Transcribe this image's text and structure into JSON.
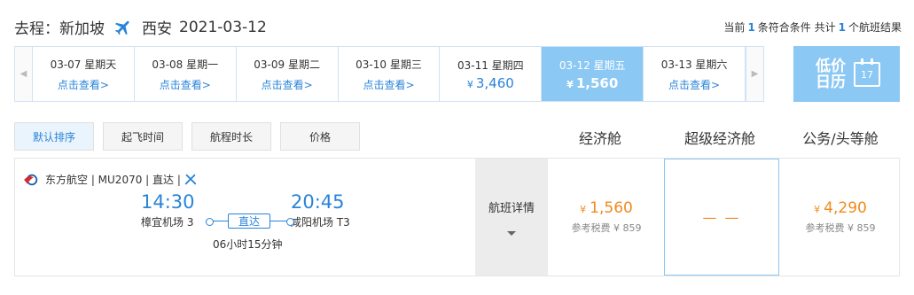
{
  "header": {
    "route_prefix": "去程：新加坡",
    "destination": "西安",
    "date": "2021-03-12",
    "result_prefix": "当前",
    "match_count": "1",
    "match_label": "条符合条件 共计",
    "total_count": "1",
    "total_label": "个航班结果"
  },
  "dates": [
    {
      "date": "03-07 星期天",
      "sub": "点击查看>",
      "type": "link"
    },
    {
      "date": "03-08 星期一",
      "sub": "点击查看>",
      "type": "link"
    },
    {
      "date": "03-09 星期二",
      "sub": "点击查看>",
      "type": "link"
    },
    {
      "date": "03-10 星期三",
      "sub": "点击查看>",
      "type": "link"
    },
    {
      "date": "03-11 星期四",
      "currency": "¥",
      "sub": "3,460",
      "type": "price"
    },
    {
      "date": "03-12 星期五",
      "currency": "¥",
      "sub": "1,560",
      "type": "price",
      "active": true
    },
    {
      "date": "03-13 星期六",
      "sub": "点击查看>",
      "type": "link"
    }
  ],
  "low_calendar": {
    "label": "低价日历",
    "day": "17"
  },
  "sort_tabs": [
    "默认排序",
    "起飞时间",
    "航程时长",
    "价格"
  ],
  "cabins": [
    "经济舱",
    "超级经济舱",
    "公务/头等舱"
  ],
  "flight": {
    "airline_info": "东方航空 | MU2070 | 直达 |",
    "depart_time": "14:30",
    "arrive_time": "20:45",
    "depart_airport": "樟宜机场 3",
    "arrive_airport": "咸阳机场 T3",
    "direct": "直达",
    "duration": "06小时15分钟",
    "detail_label": "航班详情",
    "economy_currency": "¥",
    "economy_price": "1,560",
    "economy_tax": "参考税费 ¥ 859",
    "premium_economy": "— —",
    "business_currency": "¥",
    "business_price": "4,290",
    "business_tax": "参考税费 ¥ 859"
  },
  "colors": {
    "accent": "#2a84d8",
    "active_bg": "#8cc8f4",
    "price": "#f08a1d"
  }
}
